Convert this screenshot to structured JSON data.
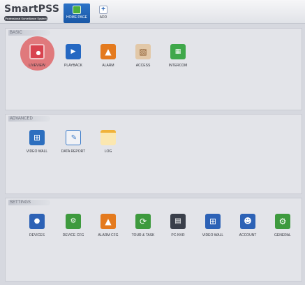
{
  "app": {
    "logo": "SmartPSS",
    "tagline": "Professional Surveillance System"
  },
  "tabs": [
    {
      "label": "HOME PAGE"
    },
    {
      "label": "ADD"
    }
  ],
  "sections": {
    "basic": {
      "title": "BASIC",
      "items": [
        {
          "label": "LIVEVIEW",
          "icon": "camera-icon",
          "color": "#d8434f"
        },
        {
          "label": "PLAYBACK",
          "icon": "clapperboard-icon",
          "color": "#2568c2"
        },
        {
          "label": "ALARM",
          "icon": "alarm-icon",
          "color": "#e47a1e"
        },
        {
          "label": "ACCESS",
          "icon": "door-icon",
          "color": "#c2743c"
        },
        {
          "label": "INTERCOM",
          "icon": "intercom-icon",
          "color": "#3fa84a"
        }
      ]
    },
    "advanced": {
      "title": "ADVANCED",
      "items": [
        {
          "label": "VIDEO WALL",
          "icon": "video-wall-icon",
          "color": "#2d6fbf"
        },
        {
          "label": "DATA REPORT",
          "icon": "notebook-icon",
          "color": "#3d7cc9"
        },
        {
          "label": "LOG",
          "icon": "log-icon",
          "color": "#f0b23a"
        }
      ]
    },
    "settings": {
      "title": "SETTINGS",
      "items": [
        {
          "label": "DEVICES",
          "icon": "devices-icon",
          "color": "#2d62b6"
        },
        {
          "label": "DEVICE CFG",
          "icon": "device-config-icon",
          "color": "#3e9a3e"
        },
        {
          "label": "ALARM CFG",
          "icon": "alarm-config-icon",
          "color": "#e47a1e"
        },
        {
          "label": "TOUR & TASK",
          "icon": "tour-task-icon",
          "color": "#3e9a3e"
        },
        {
          "label": "PC-NVR",
          "icon": "pc-nvr-icon",
          "color": "#3a3f4a"
        },
        {
          "label": "VIDEO WALL",
          "icon": "video-wall-config-icon",
          "color": "#2d62b6"
        },
        {
          "label": "ACCOUNT",
          "icon": "account-icon",
          "color": "#2d62b6"
        },
        {
          "label": "GENERAL",
          "icon": "gear-icon",
          "color": "#3e9a3e"
        }
      ]
    }
  }
}
